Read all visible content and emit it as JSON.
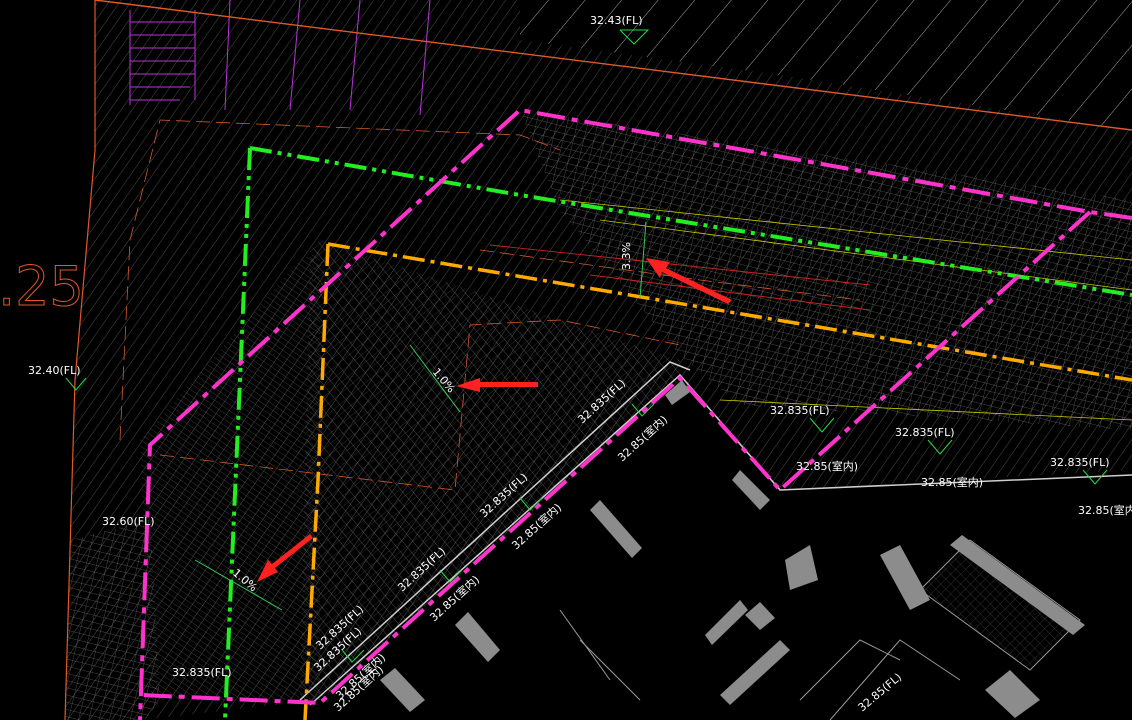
{
  "drawing": {
    "big_text": ".25",
    "elevations": {
      "top": "32.43(FL)",
      "left": "32.40(FL)",
      "left_lower": "32.60(FL)",
      "bottom_left": "32.835(FL)",
      "bottom_right": "32.85(FL)",
      "corner_fl": "32.835(FL)",
      "corner_indoor": "32.85(室内)",
      "diag_fl_1": "32.835(FL)",
      "diag_fl_2": "32.835(FL)",
      "diag_fl_3": "32.835(FL)",
      "diag_fl_4": "32.835(FL)",
      "diag_in_1": "32.85(室内)",
      "diag_in_2": "32.85(室内)",
      "diag_in_3": "32.85(室内)",
      "diag_in_4": "32.85(室内)",
      "right_fl_1": "32.835(FL)",
      "right_fl_2": "32.835(FL)",
      "right_fl_3": "32.835(FL)",
      "right_in_1": "32.85(室内)",
      "right_in_2": "32.85(室内)",
      "right_in_3": "32.85(室内)"
    },
    "slopes": {
      "s1": "3.3%",
      "s2": "1.0%",
      "s3": "1.0%"
    },
    "colors": {
      "background": "#000000",
      "site_boundary": "#e2582a",
      "magenta_dash": "#ff33cc",
      "green_dashdot": "#22ee22",
      "orange_dashdot": "#ffaa00",
      "red_arrow": "#ff2020",
      "hatch": "#9a9a9a",
      "building": "#8c8c8c",
      "purple_grid": "#bb33dd"
    }
  }
}
